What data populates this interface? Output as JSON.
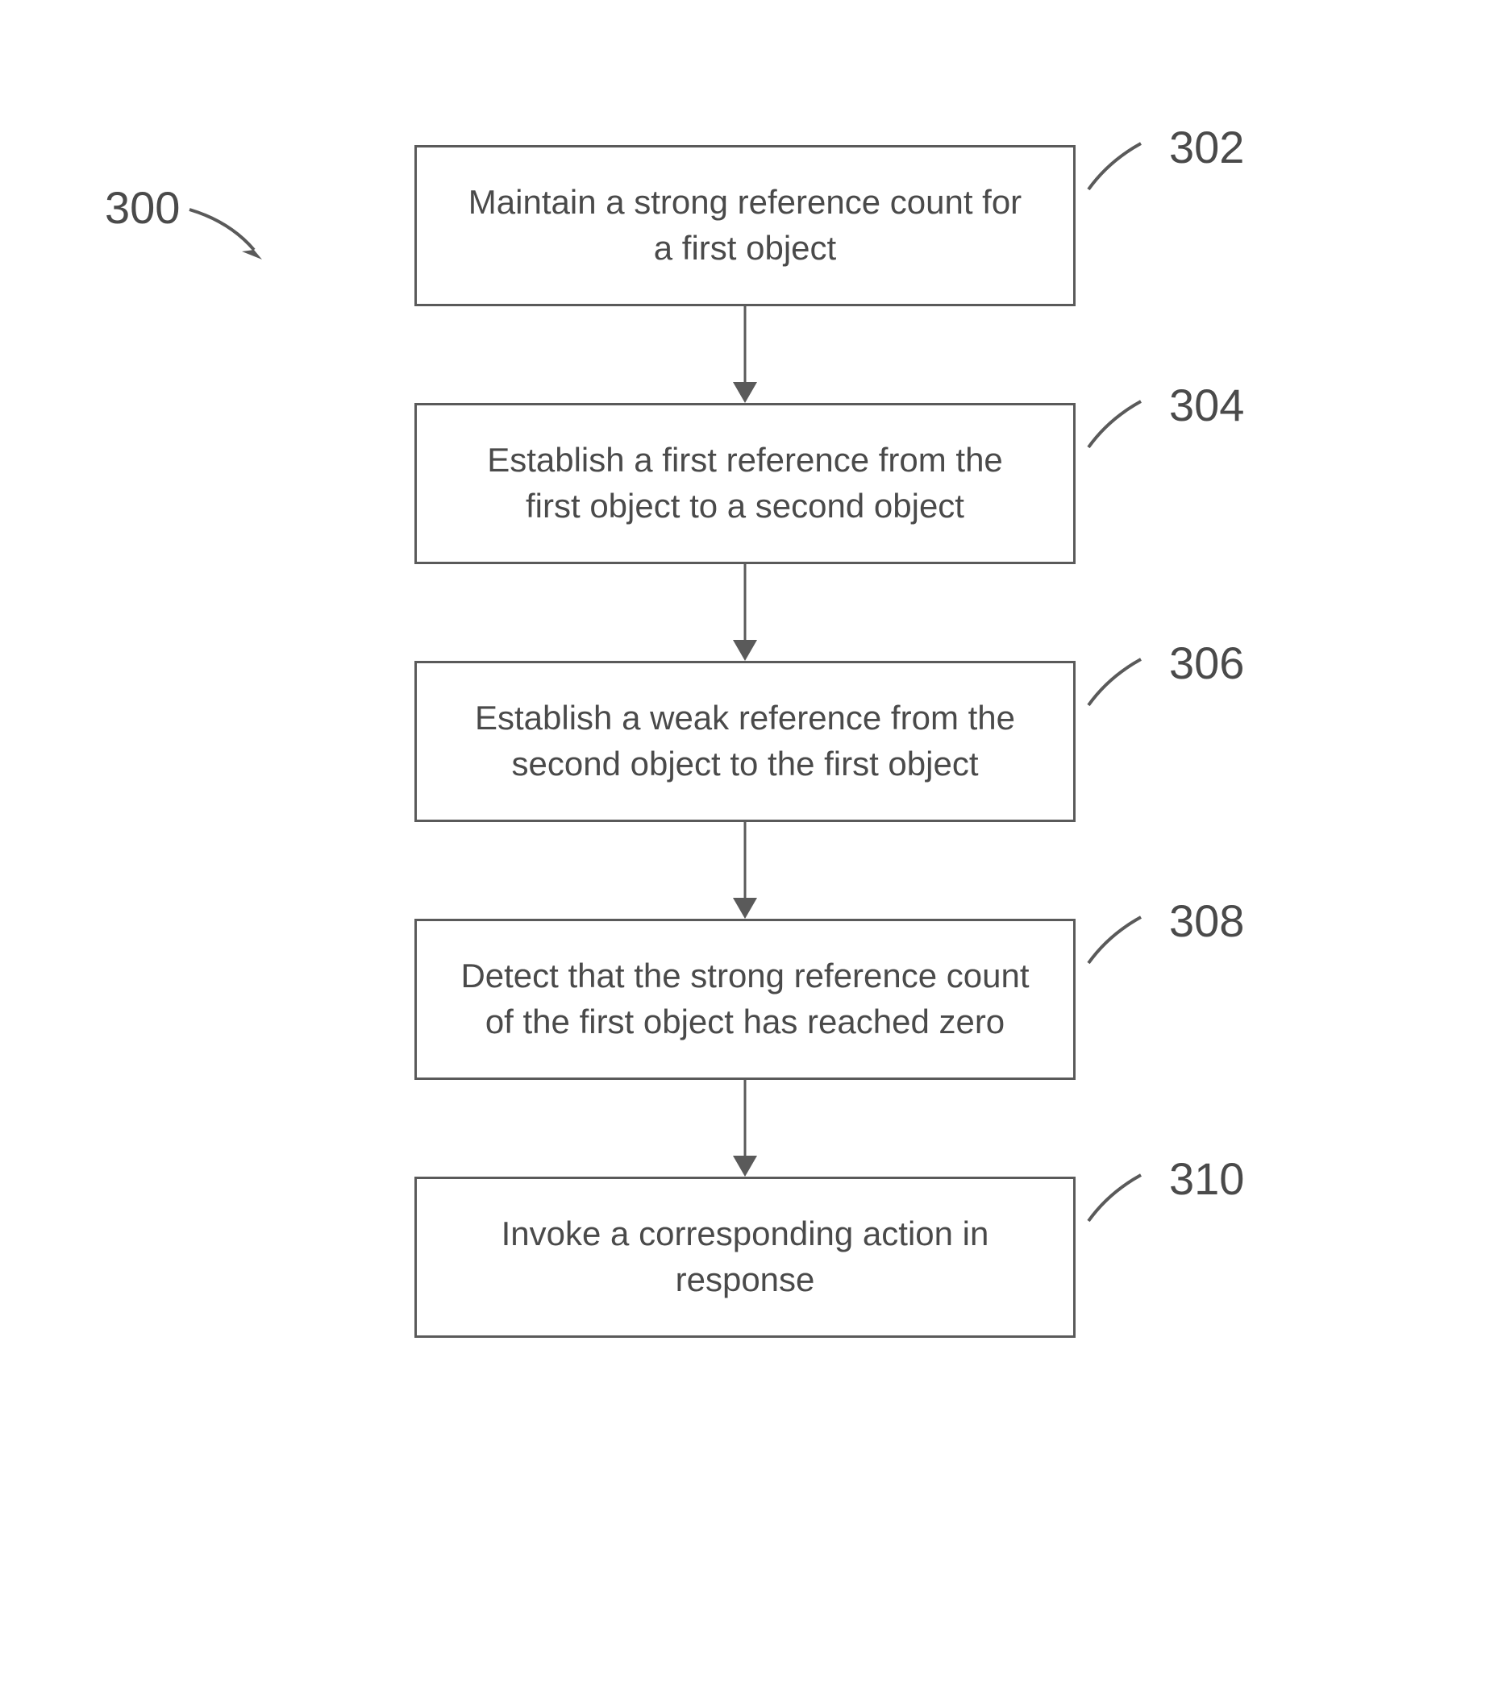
{
  "diagram": {
    "ref_label": "300",
    "steps": [
      {
        "id": "302",
        "text": "Maintain a strong reference count for a first object"
      },
      {
        "id": "304",
        "text": "Establish a first reference from the first object to a second object"
      },
      {
        "id": "306",
        "text": "Establish a weak reference from the second object to the first object"
      },
      {
        "id": "308",
        "text": "Detect that the strong reference count of the first object has reached zero"
      },
      {
        "id": "310",
        "text": "Invoke a corresponding action in response"
      }
    ]
  }
}
